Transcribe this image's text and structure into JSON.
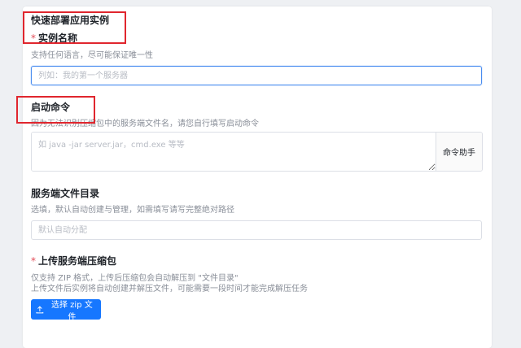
{
  "form": {
    "title": "快速部署应用实例",
    "instance_name": {
      "required_mark": "*",
      "label": "实例名称",
      "hint": "支持任何语言，尽可能保证唯一性",
      "placeholder": "列如：我的第一个服务器",
      "value": ""
    },
    "start_command": {
      "label": "启动命令",
      "hint": "因为无法识别压缩包中的服务端文件名，请您自行填写启动命令",
      "placeholder": "如 java -jar server.jar，cmd.exe 等等",
      "value": "",
      "helper_label": "命令助手"
    },
    "server_dir": {
      "label": "服务端文件目录",
      "hint": "选填，默认自动创建与管理，如需填写请写完整绝对路径",
      "placeholder": "默认自动分配",
      "value": ""
    },
    "upload": {
      "required_mark": "*",
      "label": "上传服务端压缩包",
      "hint_line1": "仅支持 ZIP 格式，上传后压缩包会自动解压到 \"文件目录\"",
      "hint_line2": "上传文件后实例将自动创建并解压文件，可能需要一段时间才能完成解压任务",
      "button_label": "选择 zip 文件",
      "button_icon": "upload-icon"
    }
  },
  "colors": {
    "primary": "#1677ff",
    "required": "#e34d59",
    "annotation": "#e0262e",
    "focus_border": "#4a8df0"
  }
}
